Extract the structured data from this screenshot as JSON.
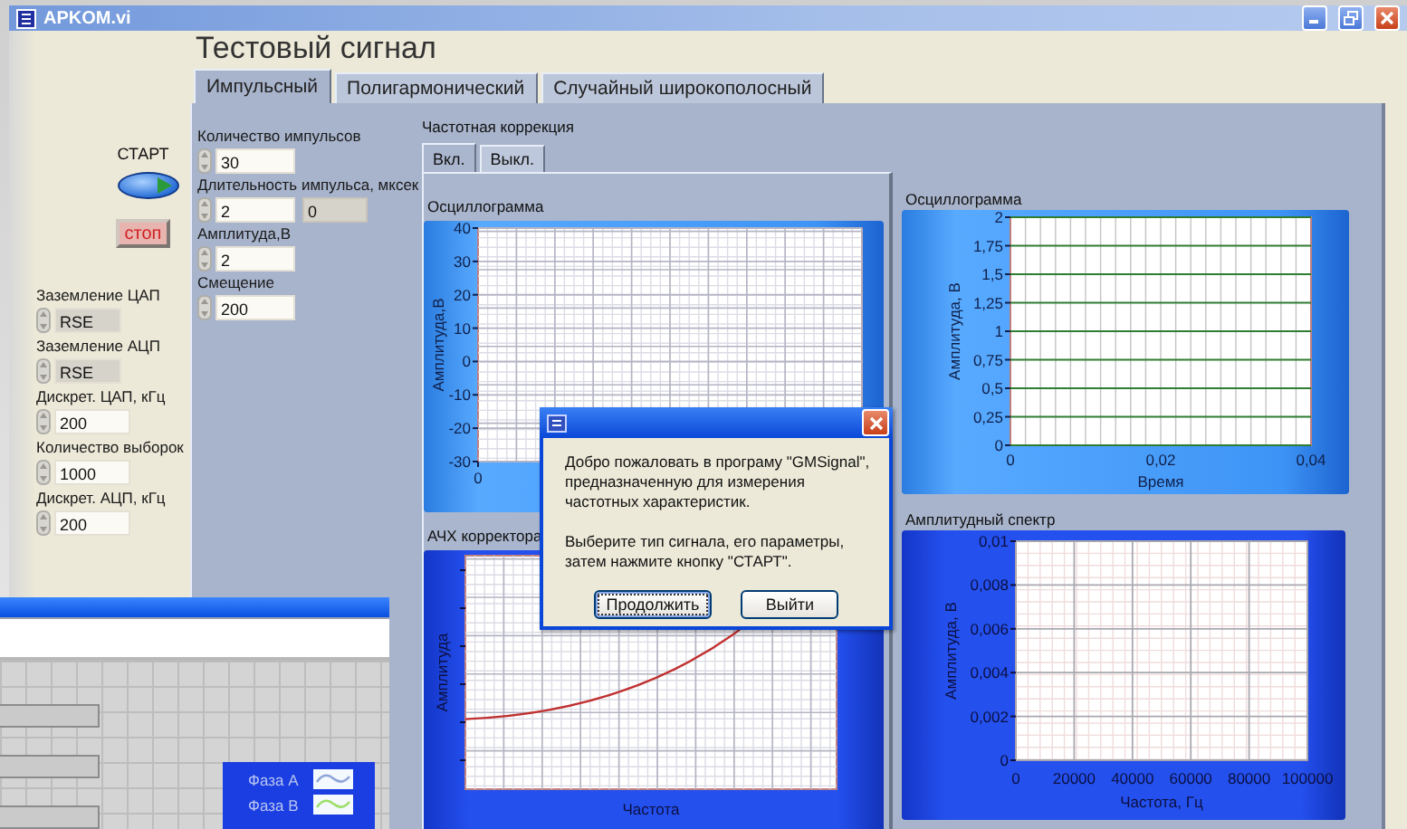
{
  "window": {
    "title": "APKOM.vi"
  },
  "start": {
    "label": "СТАРТ"
  },
  "stop": {
    "label": "стоп"
  },
  "settings": [
    {
      "label": "Заземление ЦАП",
      "value": "RSE",
      "kind": "ring"
    },
    {
      "label": "Заземление АЦП",
      "value": "RSE",
      "kind": "ring"
    },
    {
      "label": "Дискрет. ЦАП, кГц",
      "value": "200",
      "kind": "numeric"
    },
    {
      "label": "Количество выборок",
      "value": "1000",
      "kind": "numeric"
    },
    {
      "label": "Дискрет. АЦП, кГц",
      "value": "200",
      "kind": "numeric"
    }
  ],
  "panel_title": "Тестовый сигнал",
  "tabs": [
    {
      "label": "Импульсный",
      "selected": true
    },
    {
      "label": "Полигармонический",
      "selected": false
    },
    {
      "label": "Случайный широкополосный",
      "selected": false
    }
  ],
  "parameters": [
    {
      "label": "Количество импульсов",
      "value": "30"
    },
    {
      "label": "Длительность импульса, мксек",
      "value": "2",
      "readout": "0"
    },
    {
      "label": "Амплитуда,В",
      "value": "2"
    },
    {
      "label": "Смещение",
      "value": "200"
    }
  ],
  "correction": {
    "title": "Частотная коррекция",
    "tabs": [
      {
        "label": "Вкл.",
        "selected": true
      },
      {
        "label": "Выкл.",
        "selected": false
      }
    ],
    "graphs": [
      {
        "kind": "scope",
        "title": "Осциллограмма",
        "ylabel": "Амплитуда,В",
        "y_scale": [
          "40",
          "30",
          "20",
          "10",
          "0",
          "-10",
          "-20",
          "-30"
        ],
        "x_axis_start": "0"
      },
      {
        "kind": "curve",
        "title": "АЧХ корректора",
        "ylabel": "Амплитуда",
        "xlabel": "Частота"
      }
    ]
  },
  "graphs": [
    {
      "kind": "scope",
      "title": "Осциллограмма",
      "ylabel": "Амплитуда, В",
      "xlabel": "Время",
      "y_scale": [
        "2",
        "1,75",
        "1,5",
        "1,25",
        "1",
        "0,75",
        "0,5",
        "0,25",
        "0"
      ],
      "x_scale": [
        "0",
        "0,02",
        "0,04"
      ]
    },
    {
      "kind": "scope",
      "title": "Амплитудный спектр",
      "ylabel": "Амплитуда, В",
      "xlabel": "Частота, Гц",
      "y_scale": [
        "0,01",
        "0,008",
        "0,006",
        "0,004",
        "0,002",
        "0"
      ],
      "x_scale": [
        "0",
        "20000",
        "40000",
        "60000",
        "80000",
        "100000"
      ]
    }
  ],
  "background_window": {
    "legend": [
      {
        "label": "Фаза А",
        "color": "#8fa6d8"
      },
      {
        "label": "Фаза В",
        "color": "#9ee06a"
      }
    ]
  },
  "dialog": {
    "message": [
      "Добро пожаловать в програму \"GMSignal\", предназначенную для измерения частотных характеристик.",
      "Выберите тип сигнала, его параметры, затем нажмите кнопку \"СТАРТ\"."
    ],
    "buttons": [
      {
        "label": "Продолжить",
        "selected": true
      },
      {
        "label": "Выйти",
        "selected": false
      }
    ]
  }
}
